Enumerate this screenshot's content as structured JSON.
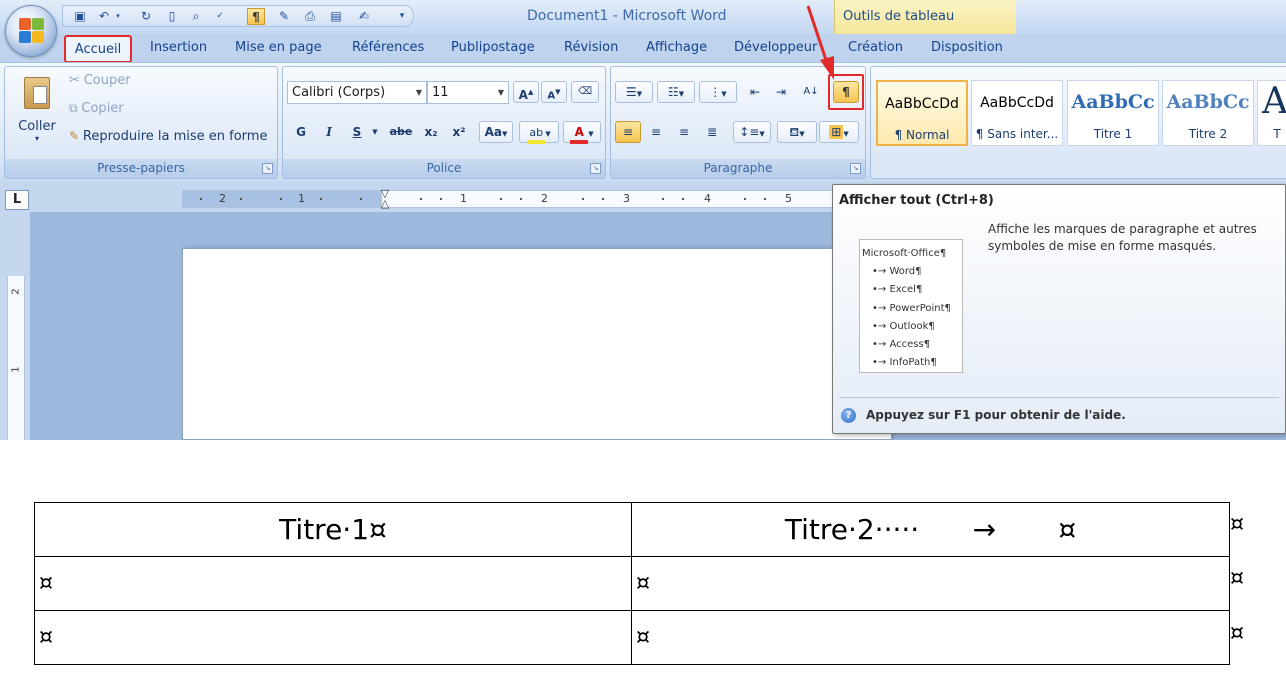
{
  "window": {
    "title": "Document1 - Microsoft Word",
    "context_title": "Outils de tableau"
  },
  "qat": {
    "show_all_glyph": "¶"
  },
  "tabs": [
    {
      "label": "Accueil",
      "active": true
    },
    {
      "label": "Insertion"
    },
    {
      "label": "Mise en page"
    },
    {
      "label": "Références"
    },
    {
      "label": "Publipostage"
    },
    {
      "label": "Révision"
    },
    {
      "label": "Affichage"
    },
    {
      "label": "Développeur"
    },
    {
      "label": "Création"
    },
    {
      "label": "Disposition"
    }
  ],
  "clipboard": {
    "label": "Presse-papiers",
    "paste": "Coller",
    "cut": "Couper",
    "copy": "Copier",
    "format_painter": "Reproduire la mise en forme"
  },
  "font": {
    "label": "Police",
    "name": "Calibri (Corps)",
    "size": "11",
    "bold": "G",
    "italic": "I",
    "underline": "S",
    "strike": "abe",
    "subscript": "x₂",
    "superscript": "x²",
    "case": "Aa",
    "color_letter": "A"
  },
  "paragraph": {
    "label": "Paragraphe",
    "show_all": "¶"
  },
  "styles": [
    {
      "sample": "AaBbCcDd",
      "name": "¶ Normal",
      "selected": true
    },
    {
      "sample": "AaBbCcDd",
      "name": "¶ Sans inter..."
    },
    {
      "sample": "AaBbCc",
      "name": "Titre 1"
    },
    {
      "sample": "AaBbCc",
      "name": "Titre 2"
    },
    {
      "sample": "A",
      "name": "T"
    }
  ],
  "ruler": {
    "tab_selector": "L",
    "h_numbers": [
      "2",
      "1",
      "1",
      "2",
      "3",
      "4",
      "5"
    ],
    "v_numbers": [
      "2",
      "1"
    ]
  },
  "tooltip": {
    "title": "Afficher tout (Ctrl+8)",
    "description": "Affiche les marques de paragraphe et autres symboles de mise en forme masqués.",
    "sample_lines": [
      "Microsoft·Office¶",
      "•→ Word¶",
      "•→ Excel¶",
      "•→ PowerPoint¶",
      "•→ Outlook¶",
      "•→ Access¶",
      "•→ InfoPath¶"
    ],
    "help": "Appuyez sur F1 pour obtenir de l'aide."
  },
  "table": {
    "header": [
      "Titre·1¤",
      "Titre·2·····      →       ¤"
    ],
    "rows": [
      [
        "¤",
        "¤"
      ],
      [
        "¤",
        "¤"
      ]
    ],
    "end_of_row": "¤"
  },
  "colors": {
    "highlight_red": "#e22a2a",
    "ribbon_text": "#15428b"
  }
}
